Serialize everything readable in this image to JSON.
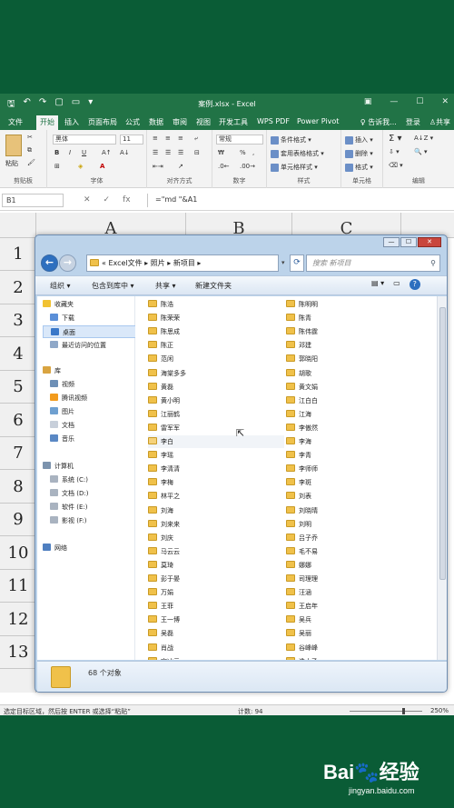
{
  "excel": {
    "title": "案例.xlsx - Excel",
    "qat": [
      "🖫",
      "↶",
      "↷",
      "▢",
      "▭",
      "▾"
    ],
    "window_buttons": [
      "▣",
      "—",
      "☐",
      "✕"
    ],
    "tabs": [
      "文件",
      "开始",
      "插入",
      "页面布局",
      "公式",
      "数据",
      "审阅",
      "视图",
      "开发工具",
      "WPS PDF",
      "Power Pivot"
    ],
    "active_tab": "开始",
    "tell_me": "告诉我...",
    "login": "登录",
    "share": "共享",
    "ribbon": {
      "paste": "粘贴",
      "clipboard": "剪贴板",
      "font_name": "黑体",
      "font_size": "11",
      "font": "字体",
      "alignment": "对齐方式",
      "number_format": "常规",
      "number": "数字",
      "conditional_format": "条件格式",
      "table_format": "套用表格格式",
      "cell_style": "单元格样式",
      "styles": "样式",
      "insert": "插入",
      "delete": "删除",
      "format": "格式",
      "cells": "单元格",
      "editing": "编辑",
      "bold": "B",
      "italic": "I",
      "underline": "U",
      "percent": "%"
    },
    "name_box": "B1",
    "formula": "=\"md \"&A1",
    "fx_icons": [
      "✕",
      "✓",
      "fx"
    ],
    "columns": [
      "A",
      "B",
      "C"
    ],
    "rows": [
      "1",
      "2",
      "3",
      "4",
      "5",
      "6",
      "7",
      "8",
      "9",
      "10",
      "11",
      "12",
      "13"
    ],
    "status_left": "选定目标区域，然后按 ENTER 或选择“粘贴”",
    "status_count": "计数: 94",
    "zoom": "250%",
    "zoom_level": 0.72
  },
  "explorer": {
    "caption_buttons": [
      "—",
      "☐",
      "✕"
    ],
    "address": "« Excel文件 ▸ 照片 ▸ 新项目 ▸",
    "search_placeholder": "搜索 新项目",
    "toolbar": [
      "组织 ▾",
      "包含到库中 ▾",
      "共享 ▾",
      "新建文件夹"
    ],
    "nav": {
      "favorites": "收藏夹",
      "download": "下载",
      "desktop": "桌面",
      "recent": "最近访问的位置",
      "library": "库",
      "videos": "视频",
      "tencent_video": "腾讯视频",
      "pictures": "图片",
      "documents": "文档",
      "music": "音乐",
      "computer": "计算机",
      "drive_c": "系统 (C:)",
      "drive_d": "文档 (D:)",
      "drive_e": "软件 (E:)",
      "drive_f": "影视 (F:)",
      "network": "网络"
    },
    "folders_col1": [
      "陈浩",
      "陈荣荣",
      "陈思成",
      "陈正",
      "范闲",
      "海棠多多",
      "黄磊",
      "黄小明",
      "江丽鹤",
      "雷军军",
      "李白",
      "李瑶",
      "李清清",
      "李梅",
      "林平之",
      "刘海",
      "刘来来",
      "刘庆",
      "马云云",
      "莫琦",
      "彭于晏",
      "万娟",
      "王菲",
      "王一博",
      "吴磊",
      "肖战",
      "宫冰云"
    ],
    "folders_col2": [
      "陈明明",
      "陈青",
      "陈伟霆",
      "邓建",
      "郭晓阳",
      "胡歌",
      "黄文娟",
      "江白白",
      "江海",
      "李傲然",
      "李海",
      "李青",
      "李师师",
      "李斑",
      "刘表",
      "刘晓晴",
      "刘明",
      "吕子乔",
      "毛不易",
      "娜娜",
      "司理理",
      "汪涵",
      "王启年",
      "吴兵",
      "吴丽",
      "谷峰峰",
      "造小乙"
    ],
    "highlighted_index": 10,
    "count": "68 个对象"
  },
  "watermark": {
    "logo": "Bai🐾经验",
    "url": "jingyan.baidu.com"
  }
}
